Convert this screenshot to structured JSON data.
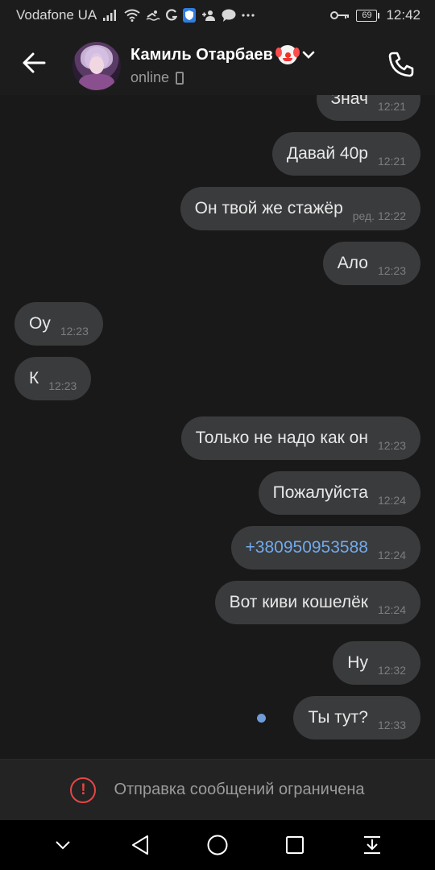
{
  "status_bar": {
    "carrier": "Vodafone UA",
    "battery": "69",
    "time": "12:42",
    "icons": [
      "signal-icon",
      "wifi-icon",
      "g-icon",
      "shield-icon",
      "add-contact-icon",
      "chat-icon",
      "more-icon",
      "key-icon",
      "battery-icon"
    ]
  },
  "header": {
    "back_icon": "arrow-left-icon",
    "name": "Камиль Отарбаев",
    "name_emoji": "clown-emoji-icon",
    "status": "online",
    "device_icon": "mobile-phone-icon",
    "call_icon": "phone-call-icon"
  },
  "messages": [
    {
      "dir": "out",
      "text": "Знач",
      "meta": "12:21"
    },
    {
      "dir": "out",
      "text": "Давай 40р",
      "meta": "12:21"
    },
    {
      "dir": "out",
      "text": "Он твой же стажёр",
      "meta": "ред. 12:22"
    },
    {
      "dir": "out",
      "text": "Ало",
      "meta": "12:23"
    },
    {
      "dir": "in",
      "text": "Оу",
      "meta": "12:23"
    },
    {
      "dir": "in",
      "text": "К",
      "meta": "12:23"
    },
    {
      "dir": "out",
      "text": "Только не надо как он",
      "meta": "12:23"
    },
    {
      "dir": "out",
      "text": "Пожалуйста",
      "meta": "12:24"
    },
    {
      "dir": "out",
      "text": "+380950953588",
      "meta": "12:24",
      "link": true
    },
    {
      "dir": "out",
      "text": "Вот киви кошелёк",
      "meta": "12:24"
    },
    {
      "dir": "out",
      "text": "Ну",
      "meta": "12:32"
    },
    {
      "dir": "out",
      "text": "Ты тут?",
      "meta": "12:33",
      "unread": true
    }
  ],
  "restriction": {
    "icon": "alert-circle-icon",
    "text": "Отправка сообщений ограничена"
  },
  "nav": {
    "icons": [
      "chevron-down-icon",
      "back-triangle-icon",
      "home-circle-icon",
      "recents-square-icon",
      "notifications-pull-icon"
    ]
  },
  "colors": {
    "background": "#191919",
    "bubble": "#3a3b3d",
    "link": "#71aaeb",
    "alert": "#e64646"
  }
}
